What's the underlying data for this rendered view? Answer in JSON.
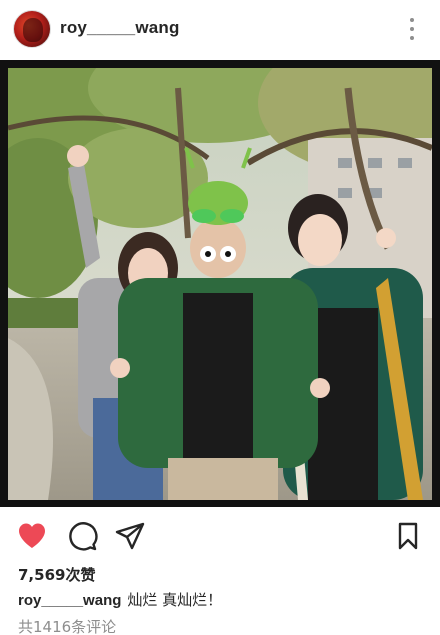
{
  "post": {
    "username": "roy_____wang",
    "likes_text": "7,569次赞",
    "caption_user": "roy_____wang",
    "caption_text": "灿烂 真灿烂！",
    "comments_text": "共1416条评论"
  },
  "icons": {
    "more": "more-vertical-icon",
    "like": "heart-filled-icon",
    "comment": "comment-bubble-icon",
    "share": "send-paper-plane-icon",
    "save": "bookmark-icon"
  },
  "colors": {
    "like_red": "#ed4956",
    "text": "#262626",
    "muted": "#8e8e8e"
  }
}
